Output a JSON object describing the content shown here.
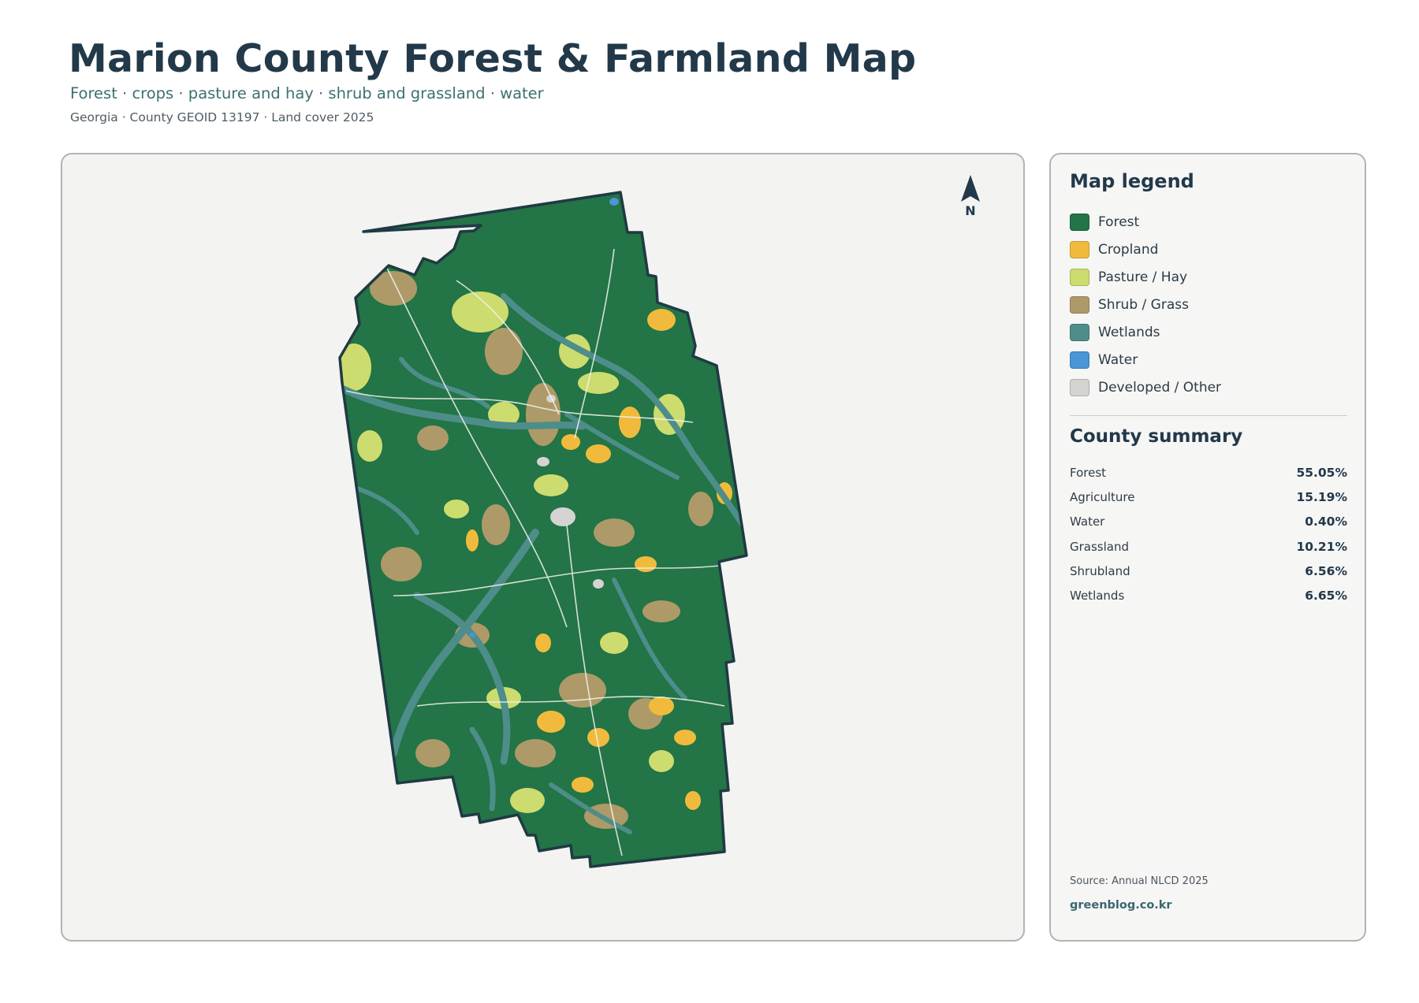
{
  "header": {
    "title": "Marion County Forest & Farmland Map",
    "subtitle": "Forest · crops · pasture and hay · shrub and grassland · water",
    "meta": "Georgia · County GEOID 13197 · Land cover 2025"
  },
  "map": {
    "north_label": "N",
    "county_outline_color": "#1f3a44",
    "background_color": "#f3f3f2"
  },
  "legend": {
    "title": "Map legend",
    "items": [
      {
        "label": "Forest",
        "color": "#237446"
      },
      {
        "label": "Cropland",
        "color": "#f0bb3c"
      },
      {
        "label": "Pasture / Hay",
        "color": "#cddc6e"
      },
      {
        "label": "Shrub / Grass",
        "color": "#ad9a68"
      },
      {
        "label": "Wetlands",
        "color": "#4d8d8a"
      },
      {
        "label": "Water",
        "color": "#4a96d6"
      },
      {
        "label": "Developed / Other",
        "color": "#d4d4d2"
      }
    ]
  },
  "summary": {
    "title": "County summary",
    "rows": [
      {
        "label": "Forest",
        "value": "55.05%"
      },
      {
        "label": "Agriculture",
        "value": "15.19%"
      },
      {
        "label": "Water",
        "value": "0.40%"
      },
      {
        "label": "Grassland",
        "value": "10.21%"
      },
      {
        "label": "Shrubland",
        "value": "6.56%"
      },
      {
        "label": "Wetlands",
        "value": "6.65%"
      }
    ]
  },
  "footer": {
    "source": "Source: Annual NLCD 2025",
    "site": "greenblog.co.kr"
  }
}
